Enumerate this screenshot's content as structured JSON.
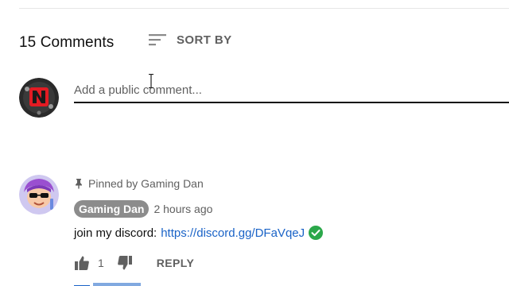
{
  "comments_header": {
    "count_label": "15 Comments",
    "sort_label": "SORT BY",
    "sort_icon": "sort-lines-icon"
  },
  "add_comment": {
    "placeholder": "Add a public comment...",
    "avatar_icon": "channel-logo-icon",
    "avatar_colors": {
      "ring": "#2a2a2a",
      "badge": "#e31b23"
    }
  },
  "pinned_comment": {
    "pinned_label": "Pinned by Gaming Dan",
    "author": "Gaming Dan",
    "time": "2 hours ago",
    "text": "join my discord:",
    "link": "https://discord.gg/DFaVqeJ",
    "link_color": "#1a63c7",
    "verified_icon": "check-circle-icon",
    "verified_color": "#2ba84a",
    "like_count": "1",
    "reply_label": "REPLY",
    "avatar_icon": "cartoon-avatar-icon"
  }
}
